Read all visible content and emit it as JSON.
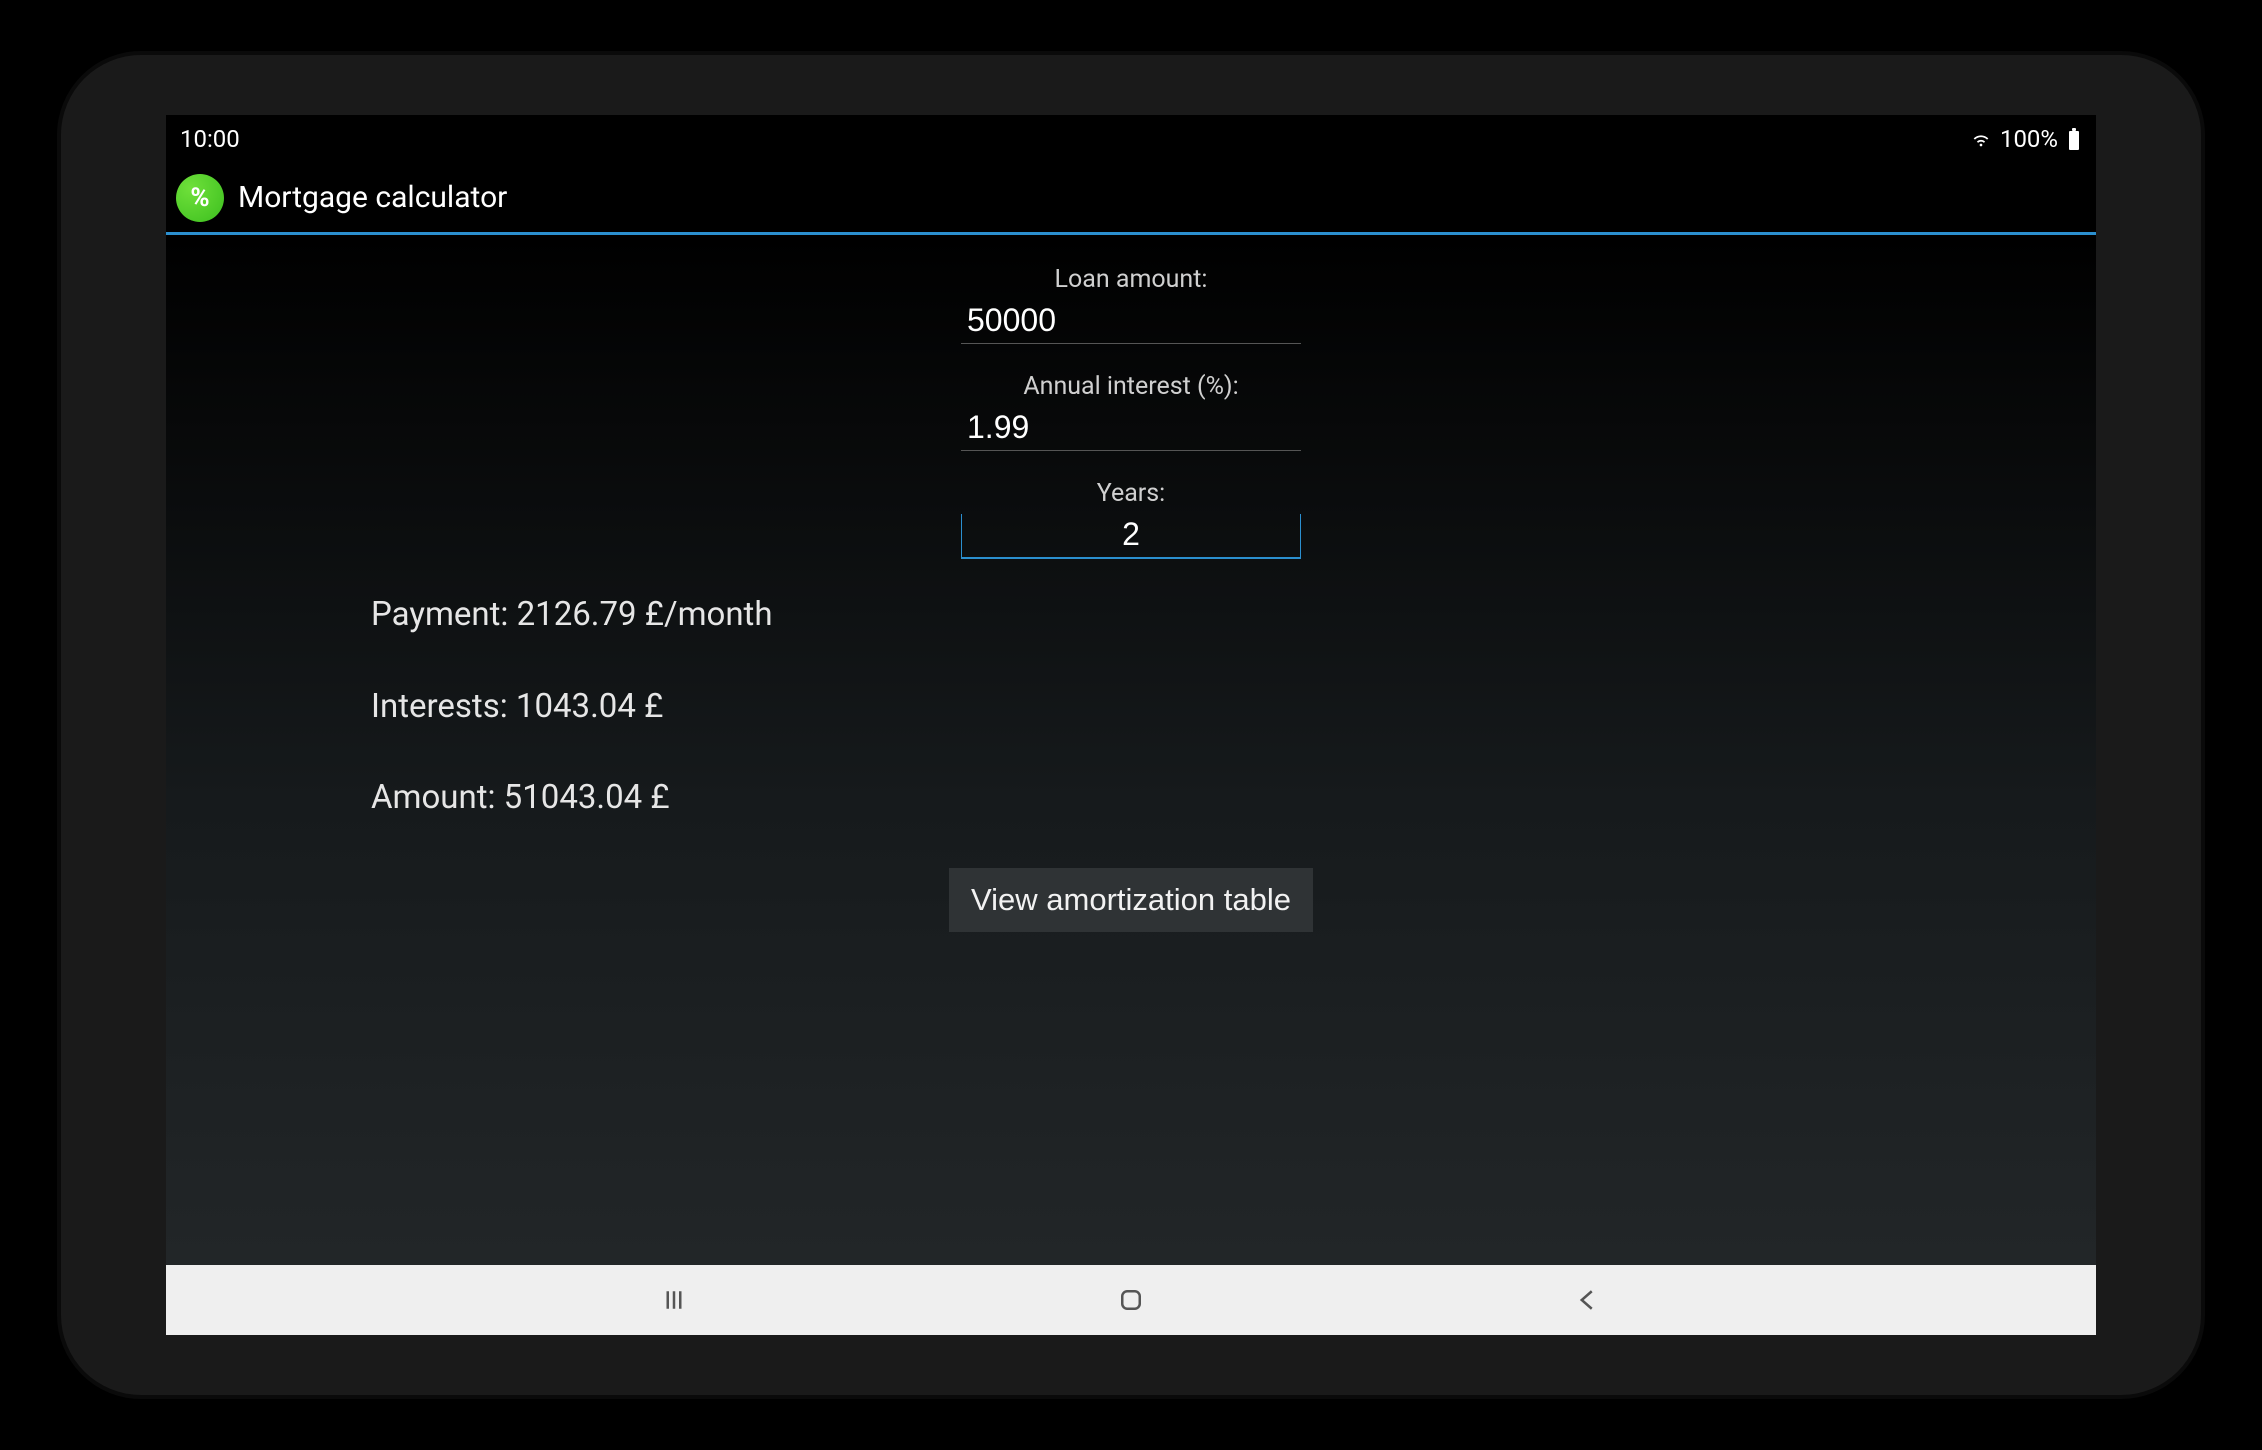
{
  "status": {
    "time": "10:00",
    "battery": "100%"
  },
  "app": {
    "title": "Mortgage calculator",
    "icon_glyph": "%"
  },
  "form": {
    "loan": {
      "label": "Loan amount:",
      "value": "50000"
    },
    "interest": {
      "label": "Annual interest (%):",
      "value": "1.99"
    },
    "years": {
      "label": "Years:",
      "value": "2"
    }
  },
  "results": {
    "payment": "Payment: 2126.79 £/month",
    "interests": "Interests: 1043.04 £",
    "amount": "Amount: 51043.04 £"
  },
  "actions": {
    "view_table": "View amortization table"
  }
}
